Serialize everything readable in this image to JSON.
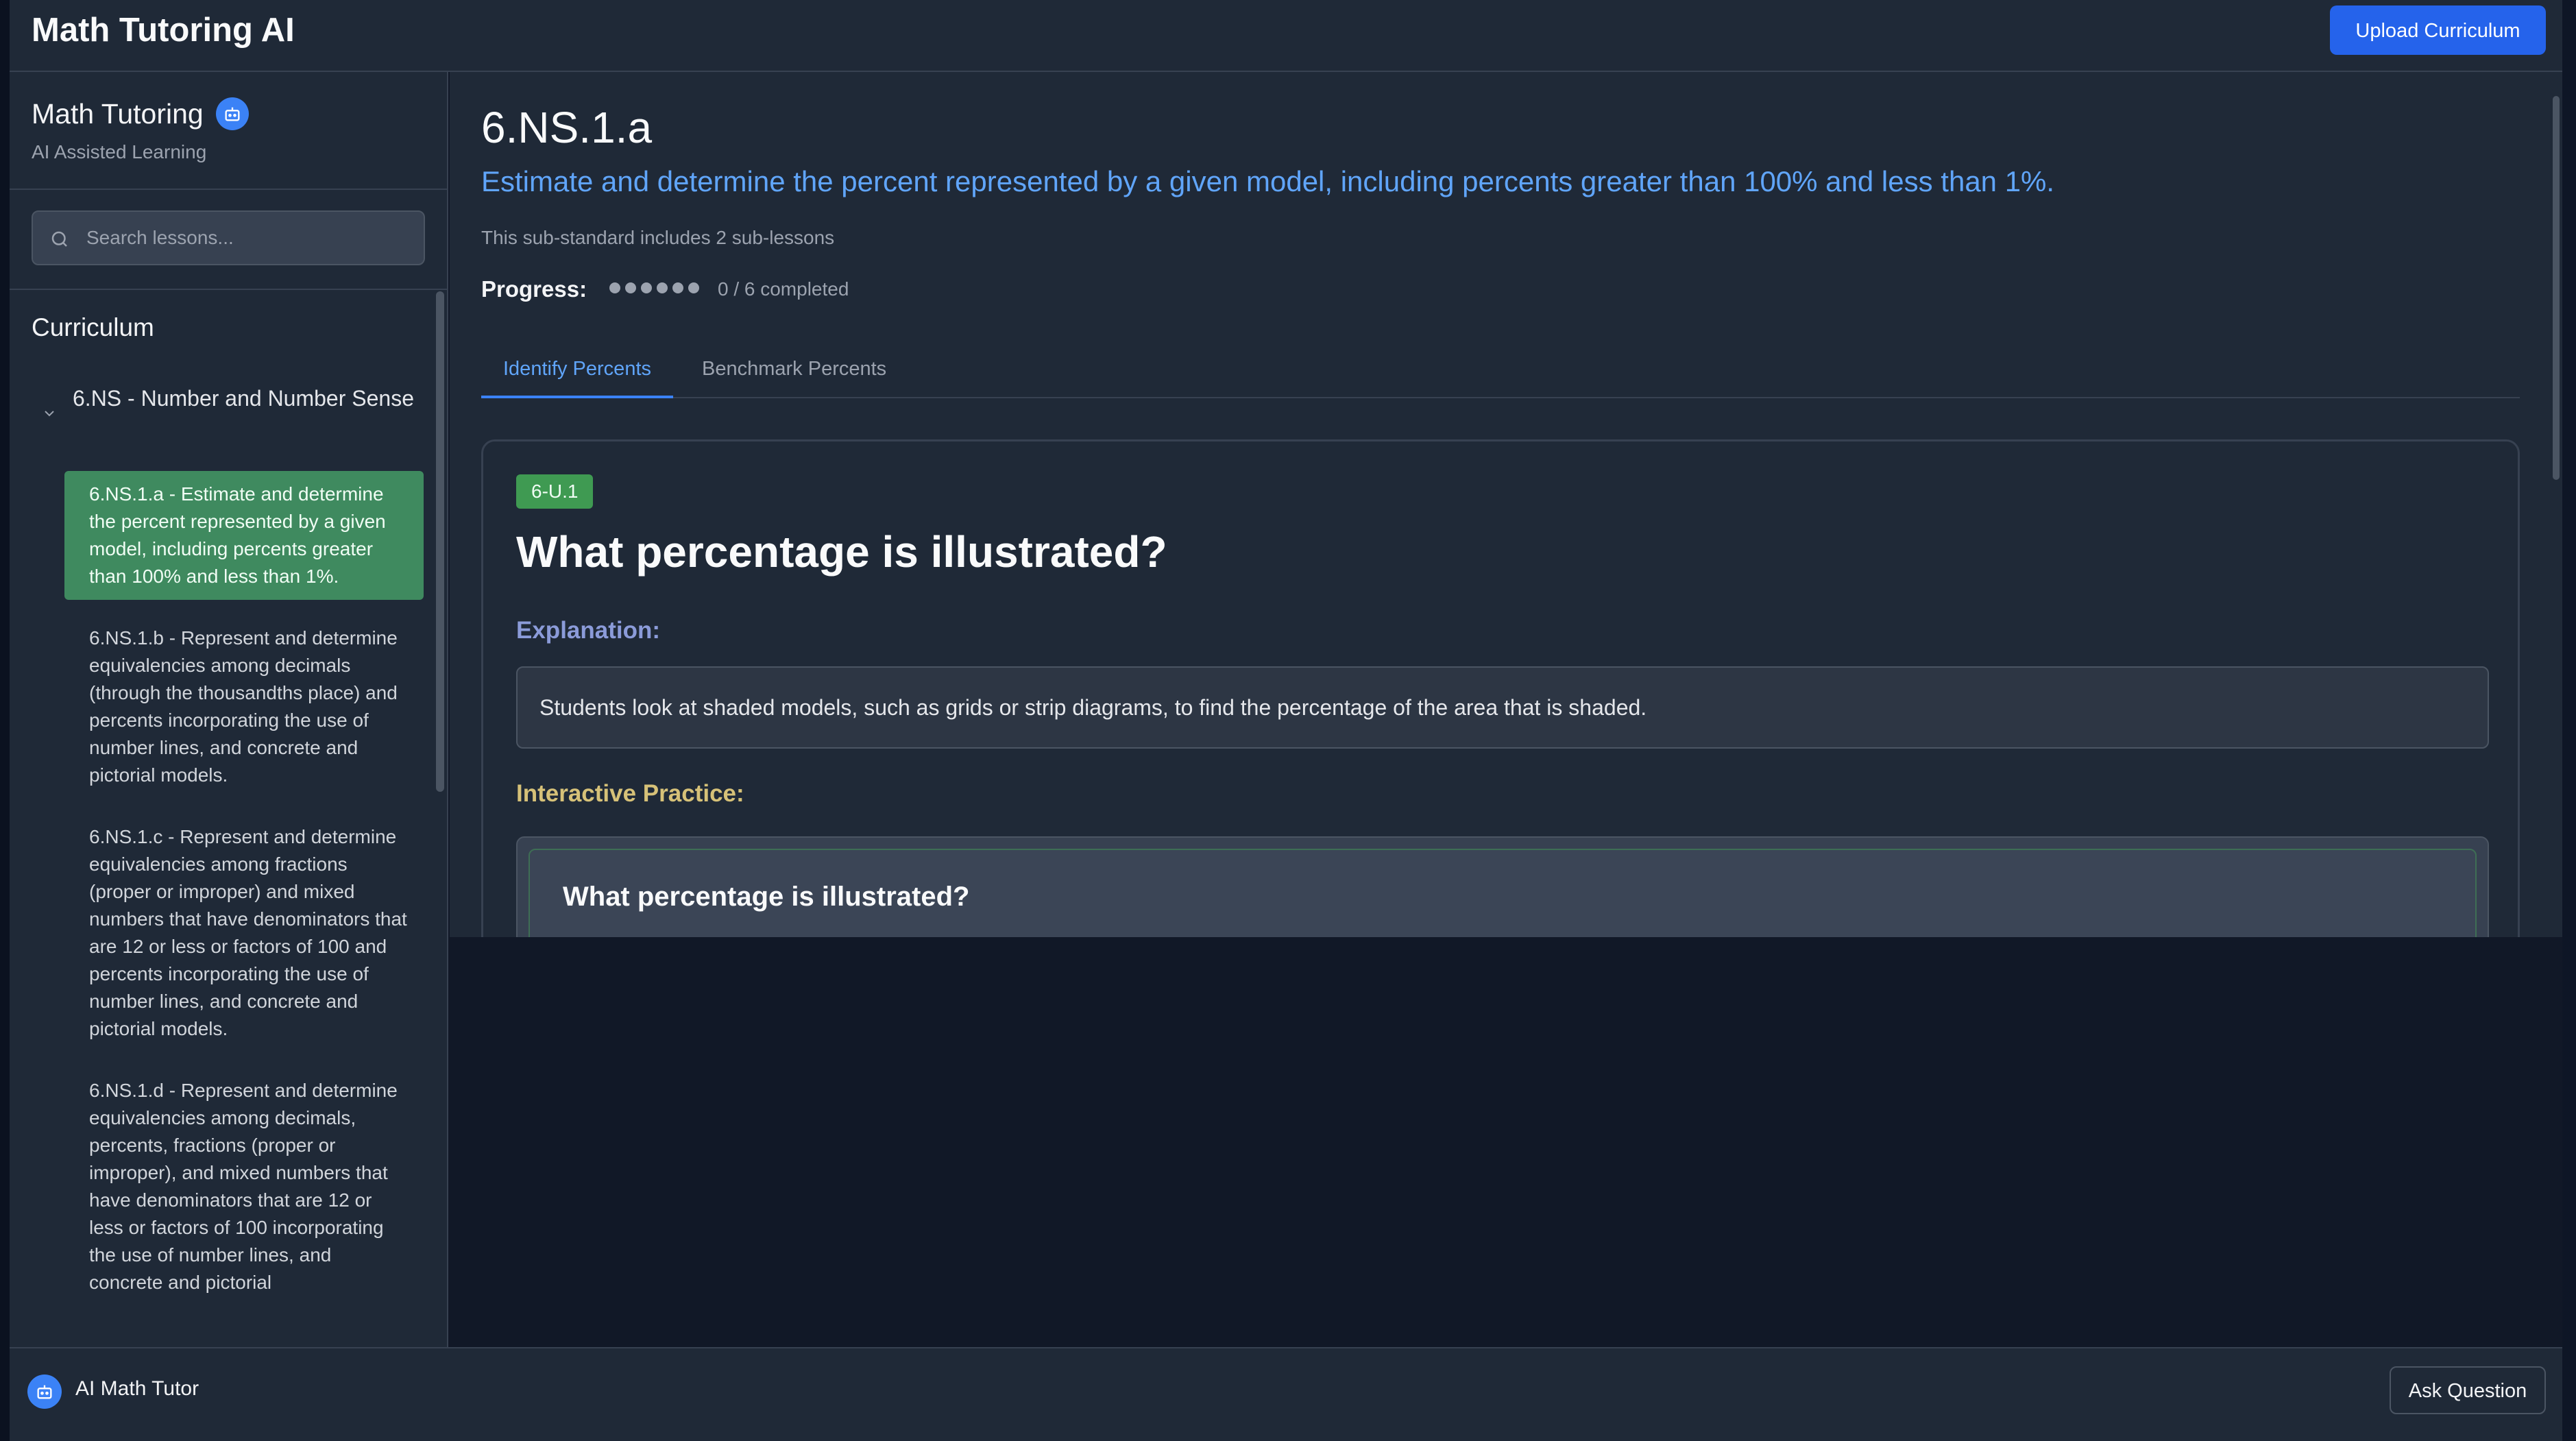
{
  "header": {
    "app_title": "Math Tutoring AI",
    "upload_label": "Upload Curriculum"
  },
  "sidebar": {
    "brand_title": "Math Tutoring",
    "brand_subtitle": "AI Assisted Learning",
    "search_placeholder": "Search lessons...",
    "search_value": "",
    "curriculum_heading": "Curriculum",
    "group_label": "6.NS - Number and Number Sense",
    "lessons": [
      {
        "label": "6.NS.1.a - Estimate and determine the percent represented by a given model, including percents greater than 100% and less than 1%.",
        "active": true
      },
      {
        "label": "6.NS.1.b - Represent and determine equivalencies among decimals (through the thousandths place) and percents incorporating the use of number lines, and concrete and pictorial models.",
        "active": false
      },
      {
        "label": "6.NS.1.c - Represent and determine equivalencies among fractions (proper or improper) and mixed numbers that have denominators that are 12 or less or factors of 100 and percents incorporating the use of number lines, and concrete and pictorial models.",
        "active": false
      },
      {
        "label": "6.NS.1.d - Represent and determine equivalencies among decimals, percents, fractions (proper or improper), and mixed numbers that have denominators that are 12 or less or factors of 100 incorporating the use of number lines, and concrete and pictorial",
        "active": false
      }
    ]
  },
  "main": {
    "standard_code": "6.NS.1.a",
    "standard_description": "Estimate and determine the percent represented by a given model, including percents greater than 100% and less than 1%.",
    "sub_note": "This sub-standard includes 2 sub-lessons",
    "progress_label": "Progress:",
    "progress_text": "0 / 6 completed",
    "progress_completed": 0,
    "progress_total": 6,
    "tabs": [
      {
        "label": "Identify Percents",
        "active": true
      },
      {
        "label": "Benchmark Percents",
        "active": false
      }
    ],
    "card": {
      "badge": "6-U.1",
      "title": "What percentage is illustrated?",
      "explanation_label": "Explanation:",
      "explanation_text": "Students look at shaded models, such as grids or strip diagrams, to find the percentage of the area that is shaded.",
      "practice_label": "Interactive Practice:",
      "practice_question": "What percentage is illustrated?"
    }
  },
  "footer": {
    "tutor_label": "AI Math Tutor",
    "ask_label": "Ask Question"
  },
  "colors": {
    "accent_blue": "#2563eb",
    "active_lesson_green": "#3f8a5f",
    "badge_green": "#3f9a52",
    "description_blue": "#60a5fa",
    "explanation_purple": "#8b9bd9",
    "practice_gold": "#d6c178"
  }
}
